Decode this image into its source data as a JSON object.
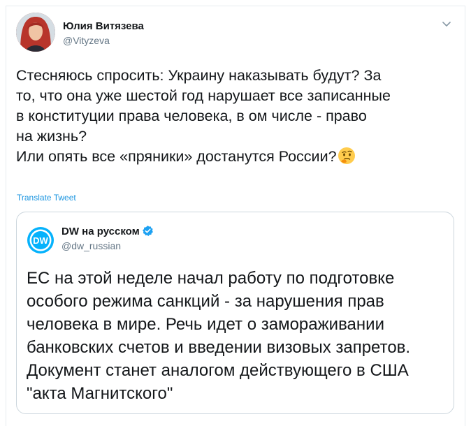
{
  "tweet": {
    "author_name": "Юлия Витязева",
    "author_handle": "@Vityzeva",
    "text_lines": [
      "Стесняюсь спросить: Украину наказывать будут? За",
      "то, что она уже шестой год нарушает все записанные",
      "в конституции права человека, в ом числе - право",
      "на жизнь?",
      "Или опять все «пряники» достанутся России?"
    ],
    "emoji": "thinking-face",
    "translate_label": "Translate Tweet"
  },
  "quoted": {
    "author_name": "DW на русском",
    "author_handle": "@dw_russian",
    "verified": true,
    "logo_text": "DW",
    "text_lines": [
      "ЕС на этой неделе начал работу по подготовке",
      "особого режима санкций - за нарушения прав",
      "человека в мире. Речь идет о замораживании",
      "банковских счетов и введении визовых запретов.",
      "Документ станет аналогом действующего в США",
      "\"акта Магнитского\""
    ]
  },
  "colors": {
    "link": "#1b95e0",
    "secondary_text": "#657786",
    "border": "#ccd6dd",
    "dw_blue": "#05b2fc",
    "verified": "#1da1f2"
  }
}
